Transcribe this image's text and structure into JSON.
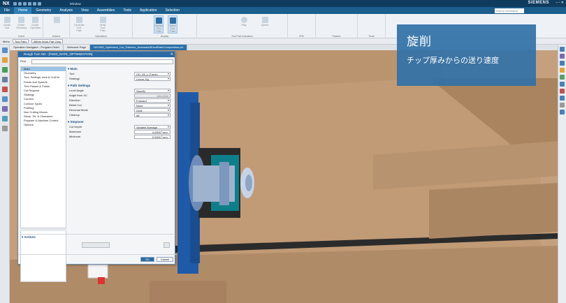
{
  "titlebar": {
    "logo": "NX",
    "window_menu": "Window",
    "brand": "SIEMENS"
  },
  "menubar": {
    "items": [
      "File",
      "Home",
      "Geometry",
      "Analysis",
      "View",
      "Assemblies",
      "Tools",
      "Application",
      "Selection"
    ],
    "active": "Home",
    "command_finder_placeholder": "Find a Command"
  },
  "ribbon": {
    "groups": [
      "Insert",
      "Actions",
      "Operations",
      "Display",
      "Tool Path Animation",
      "IPW",
      "Feature",
      "Tools"
    ],
    "buttons": [
      "Create Tool",
      "Create Geometry",
      "Create Operation",
      "Generate Tool Path",
      "Verify Tool Path",
      "Display Tool Path",
      "Select Tool Path"
    ],
    "play_label": "Play",
    "speed_label": "Speed"
  },
  "selection_bar": {
    "menu": "Menu",
    "filter": "Tool Path",
    "scope": "Within Work Part Only"
  },
  "tabs": [
    "Operation Navigator - Program Order",
    "Welcome Page",
    "NX1953_Optimized_Cut_Patterns_AutomatedFeedRateComputation.prt"
  ],
  "caption": {
    "title": "旋削",
    "subtitle": "チップ厚みからの送り速度"
  },
  "dialog": {
    "title": "Rough Turn OD - [FEED_RATE_OPTIMIZATION]",
    "find_label": "Find",
    "tree": [
      "Main",
      "Geometry",
      "Tool, Settings, Axis & CutCtrl",
      "Feeds and Speeds",
      "Trim Planes & Points",
      "Cut Regions",
      "Strategy",
      "Corners",
      "Contour Types",
      "Profiling",
      "Non Cutting Moves",
      "Stock, Tol. & Clearance",
      "Program & Machine Control",
      "Options"
    ],
    "selected_tree_item": "Main",
    "sections": {
      "main": {
        "title": "Main",
        "tool_label": "Tool",
        "tool_value": "OD_55_L (Turnin",
        "strategy_label": "Strategy",
        "strategy_value": "Linear Zig"
      },
      "path": {
        "title": "Path Settings",
        "level_angle_label": "Level Angle",
        "level_angle_value": "Specify",
        "angle_label": "Angle from XC",
        "angle_value": "180.0000",
        "direction_label": "Direction",
        "direction_value": "Forward",
        "relief_label": "Relief Cut",
        "relief_value": "None",
        "reversal_label": "Reversal Mode",
        "reversal_value": "Omit",
        "cleanup_label": "Cleanup",
        "cleanup_value": "All"
      },
      "stepover": {
        "title": "Stepover",
        "cut_depth_label": "Cut Depth",
        "cut_depth_value": "Variable Average",
        "maximum_label": "Maximum",
        "maximum_value": "4.0000",
        "minimum_label": "Minimum",
        "minimum_value": "0.0000",
        "unit": "mm"
      }
    },
    "actions_label": "Actions",
    "ok_label": "OK",
    "cancel_label": "Cancel"
  },
  "colors": {
    "title_bar": "#0f3b5f",
    "menu_bar": "#1b5d8c",
    "caption_bg": "#3171a7",
    "scene_bg": "#c9a685",
    "part_blue": "#1f5aa8"
  }
}
